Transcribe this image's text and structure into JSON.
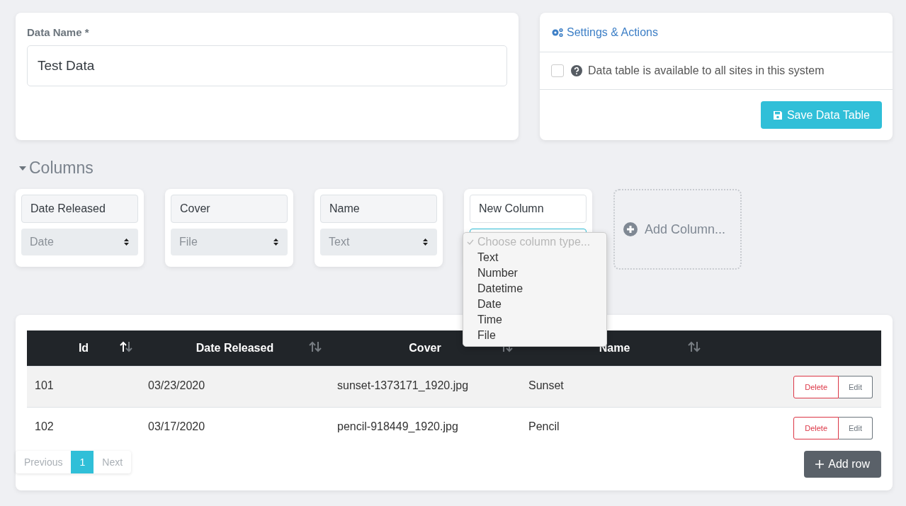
{
  "data_name": {
    "label": "Data Name *",
    "value": "Test Data"
  },
  "settings": {
    "title": "Settings & Actions",
    "shared_checkbox": {
      "label": "Data table is available to all sites in this system",
      "checked": false
    },
    "save_button": "Save Data Table"
  },
  "columns_section": {
    "title": "Columns",
    "expanded": true,
    "columns": [
      {
        "name": "Date Released",
        "type": "Date"
      },
      {
        "name": "Cover",
        "type": "File"
      },
      {
        "name": "Name",
        "type": "Text"
      },
      {
        "name": "New Column",
        "type_menu": {
          "options": [
            {
              "label": "Choose column type...",
              "selected": true,
              "disabled": true
            },
            {
              "label": "Text",
              "selected": false,
              "disabled": false
            },
            {
              "label": "Number",
              "selected": false,
              "disabled": false
            },
            {
              "label": "Datetime",
              "selected": false,
              "disabled": false
            },
            {
              "label": "Date",
              "selected": false,
              "disabled": false
            },
            {
              "label": "Time",
              "selected": false,
              "disabled": false
            },
            {
              "label": "File",
              "selected": false,
              "disabled": false
            }
          ]
        }
      }
    ],
    "add_column": "Add Column..."
  },
  "table": {
    "columns": [
      {
        "label": "Id",
        "sorted": true
      },
      {
        "label": "Date Released",
        "sorted": false
      },
      {
        "label": "Cover",
        "sorted": false
      },
      {
        "label": "Name",
        "sorted": false
      }
    ],
    "rows": [
      {
        "cells": [
          "101",
          "03/23/2020",
          "sunset-1373171_1920.jpg",
          "Sunset"
        ],
        "delete": "Delete",
        "edit": "Edit"
      },
      {
        "cells": [
          "102",
          "03/17/2020",
          "pencil-918449_1920.jpg",
          "Pencil"
        ],
        "delete": "Delete",
        "edit": "Edit"
      }
    ],
    "pagination": {
      "previous": {
        "label": "Previous",
        "disabled": true
      },
      "pages": [
        {
          "label": "1",
          "selected": true
        }
      ],
      "next": {
        "label": "Next",
        "disabled": true
      }
    },
    "add_row": "Add row"
  }
}
